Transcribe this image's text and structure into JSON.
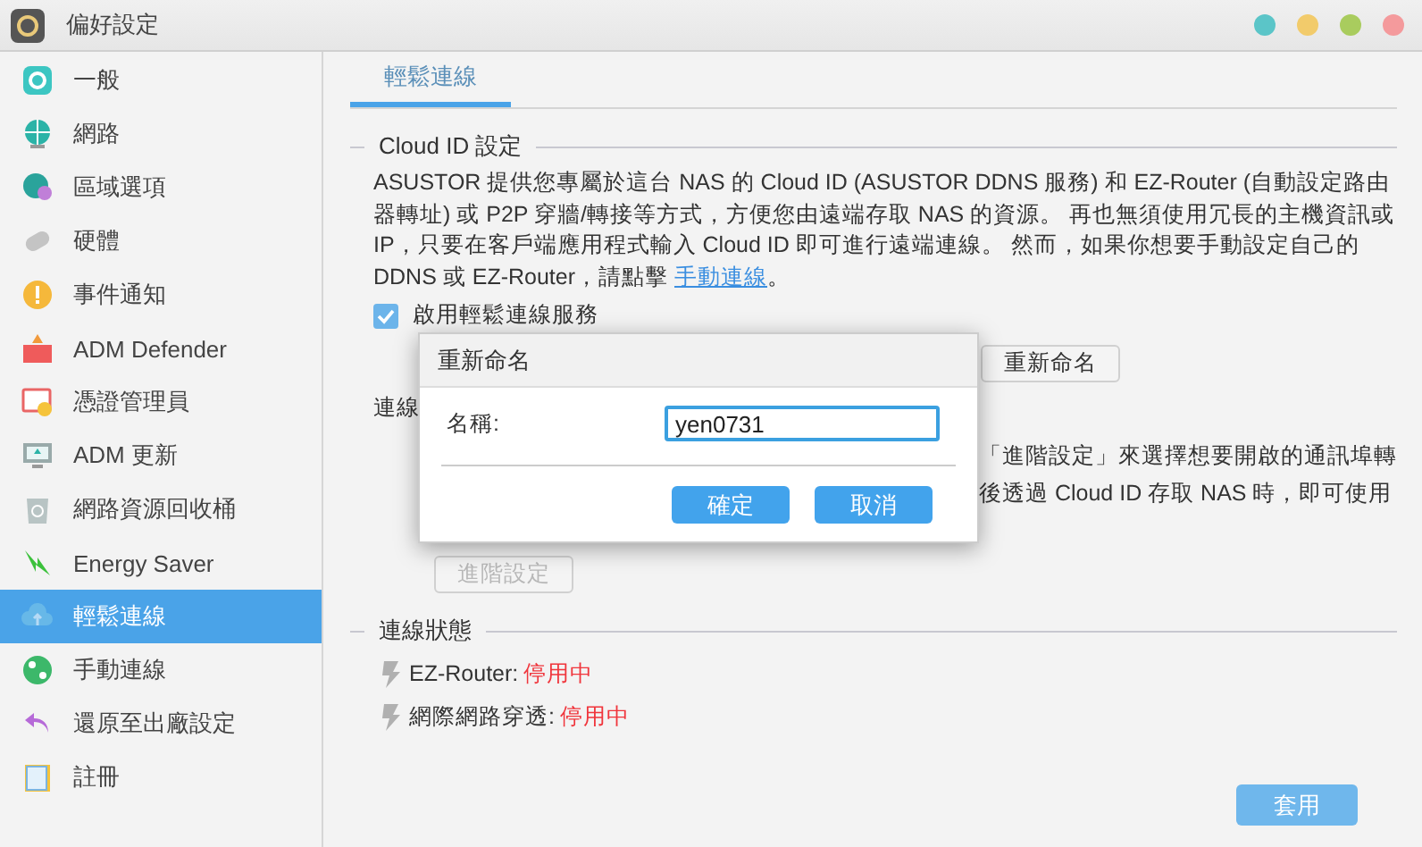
{
  "window": {
    "title": "偏好設定",
    "controls": [
      {
        "color": "#5bc5c8"
      },
      {
        "color": "#f2cb6b"
      },
      {
        "color": "#a9cc5e"
      },
      {
        "color": "#f49a9c"
      }
    ]
  },
  "sidebar": {
    "items": [
      {
        "label": "一般",
        "selected": false
      },
      {
        "label": "網路",
        "selected": false
      },
      {
        "label": "區域選項",
        "selected": false
      },
      {
        "label": "硬體",
        "selected": false
      },
      {
        "label": "事件通知",
        "selected": false
      },
      {
        "label": "ADM Defender",
        "selected": false
      },
      {
        "label": "憑證管理員",
        "selected": false
      },
      {
        "label": "ADM 更新",
        "selected": false
      },
      {
        "label": "網路資源回收桶",
        "selected": false
      },
      {
        "label": "Energy Saver",
        "selected": false
      },
      {
        "label": "輕鬆連線",
        "selected": true
      },
      {
        "label": "手動連線",
        "selected": false
      },
      {
        "label": "還原至出廠設定",
        "selected": false
      },
      {
        "label": "註冊",
        "selected": false
      }
    ]
  },
  "tabs": [
    {
      "label": "輕鬆連線",
      "selected": true
    }
  ],
  "cloud_section": {
    "title": "Cloud ID 設定",
    "text": "ASUSTOR 提供您專屬於這台 NAS 的 Cloud ID (ASUSTOR DDNS 服務) 和 EZ-Router (自動設定路由器轉址) 或 P2P 穿牆/轉接等方式，方便您由遠端存取 NAS 的資源。 再也無須使用冗長的主機資訊或 IP，只要在客戶端應用程式輸入 Cloud ID 即可進行遠端連線。 然而，如果你想要手動設定自己的 DDNS 或  EZ-Router，請點擊 ",
    "link": "手動連線",
    "text_end": "。",
    "checkbox": {
      "label": "啟用輕鬆連線服務",
      "checked": true
    },
    "rename_button": "重新命名",
    "connection_label": "連線",
    "partial_lines": [
      "「進階設定」來選擇想要開啟的通訊埠轉",
      "後透過 Cloud ID 存取 NAS 時，即可使用"
    ],
    "advanced_button": {
      "label": "進階設定",
      "disabled": true
    }
  },
  "status_section": {
    "title": "連線狀態",
    "items": [
      {
        "label": "EZ-Router:",
        "value": "停用中"
      },
      {
        "label": "網際網路穿透:",
        "value": "停用中"
      }
    ]
  },
  "apply_button": "套用",
  "dialog": {
    "title": "重新命名",
    "field_label": "名稱:",
    "value": "yen0731",
    "buttons": [
      "確定",
      "取消"
    ]
  }
}
